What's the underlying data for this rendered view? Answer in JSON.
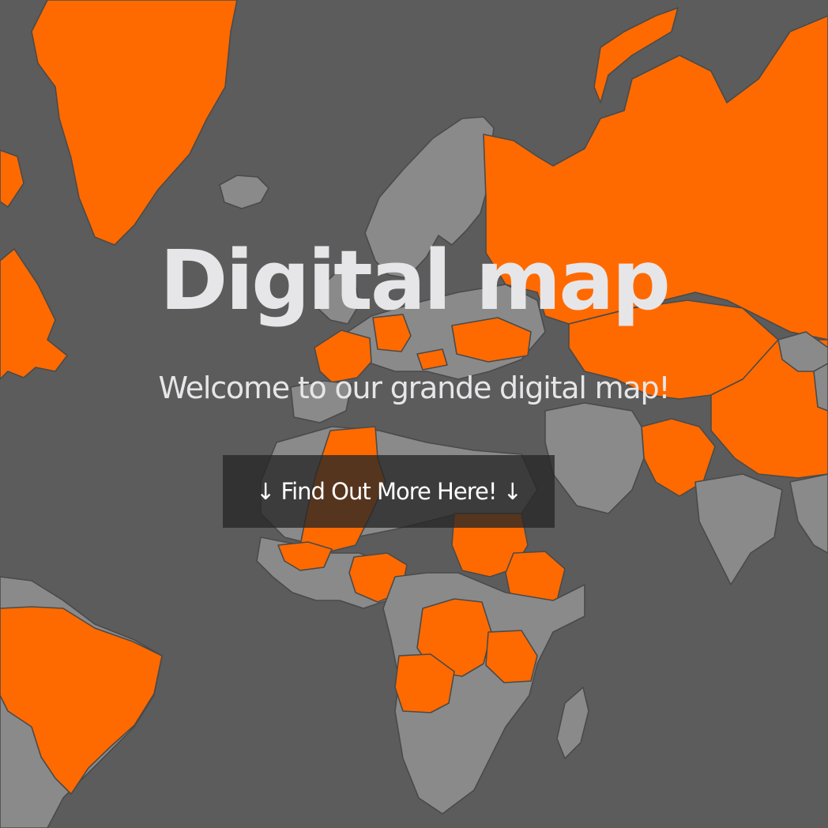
{
  "hero": {
    "title": "Digital map",
    "subtitle": "Welcome to our grande digital map!",
    "cta_label": "↓ Find Out More Here! ↓"
  },
  "map": {
    "background_color": "#5c5c5c",
    "land_color": "#8a8a8a",
    "highlight_color": "#ff6a00",
    "border_color": "#4a4a4a"
  },
  "cta_style": {
    "background": "rgba(38,38,38,0.78)",
    "text_color": "#ffffff"
  }
}
